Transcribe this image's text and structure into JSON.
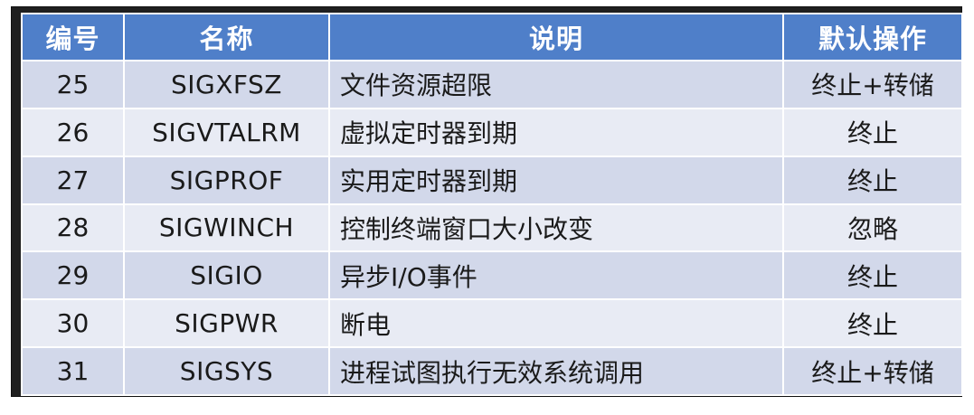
{
  "table": {
    "headers": {
      "number": "编号",
      "name": "名称",
      "description": "说明",
      "default_action": "默认操作"
    },
    "rows": [
      {
        "number": "25",
        "name": "SIGXFSZ",
        "description": "文件资源超限",
        "default_action": "终止+转储"
      },
      {
        "number": "26",
        "name": "SIGVTALRM",
        "description": "虚拟定时器到期",
        "default_action": "终止"
      },
      {
        "number": "27",
        "name": "SIGPROF",
        "description": "实用定时器到期",
        "default_action": "终止"
      },
      {
        "number": "28",
        "name": "SIGWINCH",
        "description": "控制终端窗口大小改变",
        "default_action": "忽略"
      },
      {
        "number": "29",
        "name": "SIGIO",
        "description": "异步I/O事件",
        "default_action": "终止"
      },
      {
        "number": "30",
        "name": "SIGPWR",
        "description": "断电",
        "default_action": "终止"
      },
      {
        "number": "31",
        "name": "SIGSYS",
        "description": "进程试图执行无效系统调用",
        "default_action": "终止+转储"
      }
    ]
  },
  "colors": {
    "header_bg": "#4f7fc9",
    "row_odd_bg": "#d2d8ea",
    "row_even_bg": "#e8ebf4",
    "frame": "#1f1f1f"
  }
}
